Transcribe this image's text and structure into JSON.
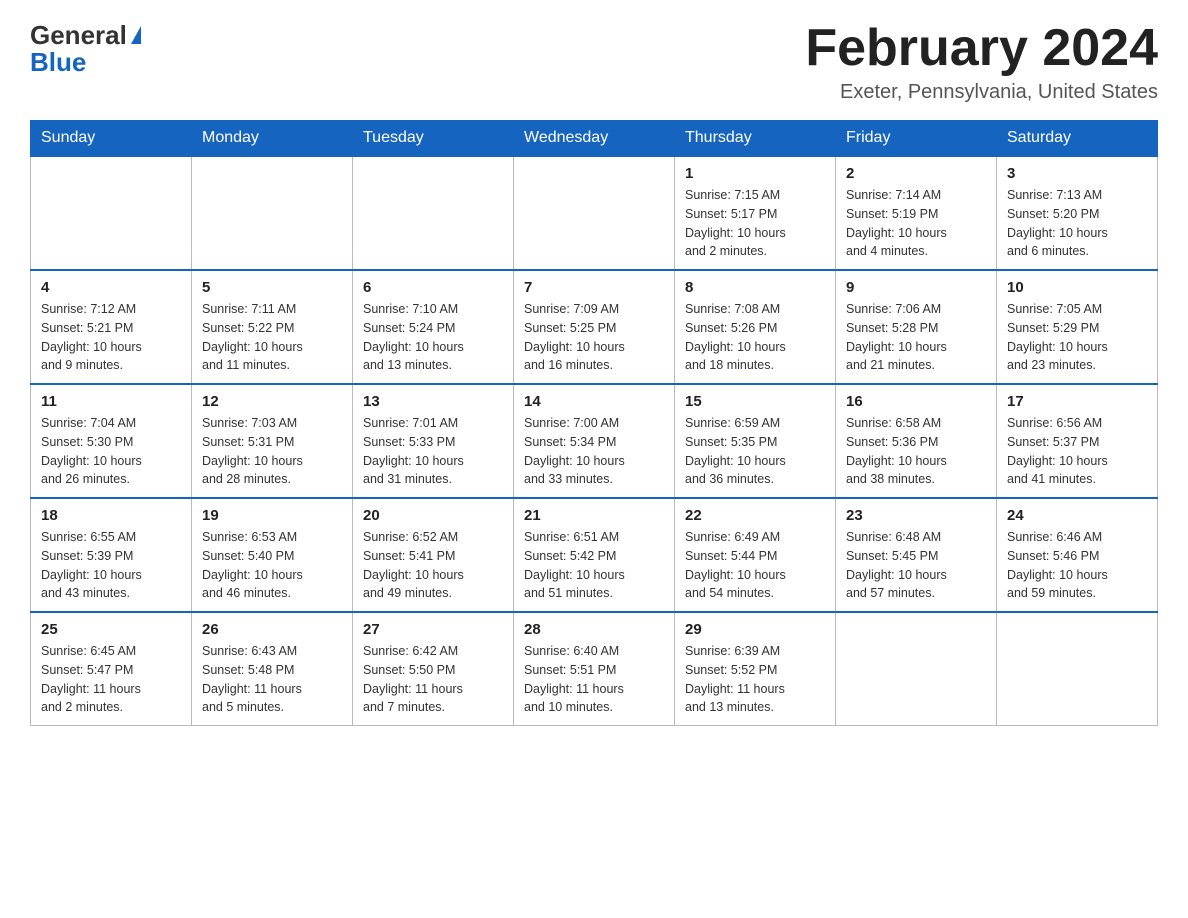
{
  "header": {
    "logo_general": "General",
    "logo_blue": "Blue",
    "month_title": "February 2024",
    "location": "Exeter, Pennsylvania, United States"
  },
  "days_of_week": [
    "Sunday",
    "Monday",
    "Tuesday",
    "Wednesday",
    "Thursday",
    "Friday",
    "Saturday"
  ],
  "weeks": [
    [
      {
        "day": "",
        "info": ""
      },
      {
        "day": "",
        "info": ""
      },
      {
        "day": "",
        "info": ""
      },
      {
        "day": "",
        "info": ""
      },
      {
        "day": "1",
        "info": "Sunrise: 7:15 AM\nSunset: 5:17 PM\nDaylight: 10 hours\nand 2 minutes."
      },
      {
        "day": "2",
        "info": "Sunrise: 7:14 AM\nSunset: 5:19 PM\nDaylight: 10 hours\nand 4 minutes."
      },
      {
        "day": "3",
        "info": "Sunrise: 7:13 AM\nSunset: 5:20 PM\nDaylight: 10 hours\nand 6 minutes."
      }
    ],
    [
      {
        "day": "4",
        "info": "Sunrise: 7:12 AM\nSunset: 5:21 PM\nDaylight: 10 hours\nand 9 minutes."
      },
      {
        "day": "5",
        "info": "Sunrise: 7:11 AM\nSunset: 5:22 PM\nDaylight: 10 hours\nand 11 minutes."
      },
      {
        "day": "6",
        "info": "Sunrise: 7:10 AM\nSunset: 5:24 PM\nDaylight: 10 hours\nand 13 minutes."
      },
      {
        "day": "7",
        "info": "Sunrise: 7:09 AM\nSunset: 5:25 PM\nDaylight: 10 hours\nand 16 minutes."
      },
      {
        "day": "8",
        "info": "Sunrise: 7:08 AM\nSunset: 5:26 PM\nDaylight: 10 hours\nand 18 minutes."
      },
      {
        "day": "9",
        "info": "Sunrise: 7:06 AM\nSunset: 5:28 PM\nDaylight: 10 hours\nand 21 minutes."
      },
      {
        "day": "10",
        "info": "Sunrise: 7:05 AM\nSunset: 5:29 PM\nDaylight: 10 hours\nand 23 minutes."
      }
    ],
    [
      {
        "day": "11",
        "info": "Sunrise: 7:04 AM\nSunset: 5:30 PM\nDaylight: 10 hours\nand 26 minutes."
      },
      {
        "day": "12",
        "info": "Sunrise: 7:03 AM\nSunset: 5:31 PM\nDaylight: 10 hours\nand 28 minutes."
      },
      {
        "day": "13",
        "info": "Sunrise: 7:01 AM\nSunset: 5:33 PM\nDaylight: 10 hours\nand 31 minutes."
      },
      {
        "day": "14",
        "info": "Sunrise: 7:00 AM\nSunset: 5:34 PM\nDaylight: 10 hours\nand 33 minutes."
      },
      {
        "day": "15",
        "info": "Sunrise: 6:59 AM\nSunset: 5:35 PM\nDaylight: 10 hours\nand 36 minutes."
      },
      {
        "day": "16",
        "info": "Sunrise: 6:58 AM\nSunset: 5:36 PM\nDaylight: 10 hours\nand 38 minutes."
      },
      {
        "day": "17",
        "info": "Sunrise: 6:56 AM\nSunset: 5:37 PM\nDaylight: 10 hours\nand 41 minutes."
      }
    ],
    [
      {
        "day": "18",
        "info": "Sunrise: 6:55 AM\nSunset: 5:39 PM\nDaylight: 10 hours\nand 43 minutes."
      },
      {
        "day": "19",
        "info": "Sunrise: 6:53 AM\nSunset: 5:40 PM\nDaylight: 10 hours\nand 46 minutes."
      },
      {
        "day": "20",
        "info": "Sunrise: 6:52 AM\nSunset: 5:41 PM\nDaylight: 10 hours\nand 49 minutes."
      },
      {
        "day": "21",
        "info": "Sunrise: 6:51 AM\nSunset: 5:42 PM\nDaylight: 10 hours\nand 51 minutes."
      },
      {
        "day": "22",
        "info": "Sunrise: 6:49 AM\nSunset: 5:44 PM\nDaylight: 10 hours\nand 54 minutes."
      },
      {
        "day": "23",
        "info": "Sunrise: 6:48 AM\nSunset: 5:45 PM\nDaylight: 10 hours\nand 57 minutes."
      },
      {
        "day": "24",
        "info": "Sunrise: 6:46 AM\nSunset: 5:46 PM\nDaylight: 10 hours\nand 59 minutes."
      }
    ],
    [
      {
        "day": "25",
        "info": "Sunrise: 6:45 AM\nSunset: 5:47 PM\nDaylight: 11 hours\nand 2 minutes."
      },
      {
        "day": "26",
        "info": "Sunrise: 6:43 AM\nSunset: 5:48 PM\nDaylight: 11 hours\nand 5 minutes."
      },
      {
        "day": "27",
        "info": "Sunrise: 6:42 AM\nSunset: 5:50 PM\nDaylight: 11 hours\nand 7 minutes."
      },
      {
        "day": "28",
        "info": "Sunrise: 6:40 AM\nSunset: 5:51 PM\nDaylight: 11 hours\nand 10 minutes."
      },
      {
        "day": "29",
        "info": "Sunrise: 6:39 AM\nSunset: 5:52 PM\nDaylight: 11 hours\nand 13 minutes."
      },
      {
        "day": "",
        "info": ""
      },
      {
        "day": "",
        "info": ""
      }
    ]
  ]
}
